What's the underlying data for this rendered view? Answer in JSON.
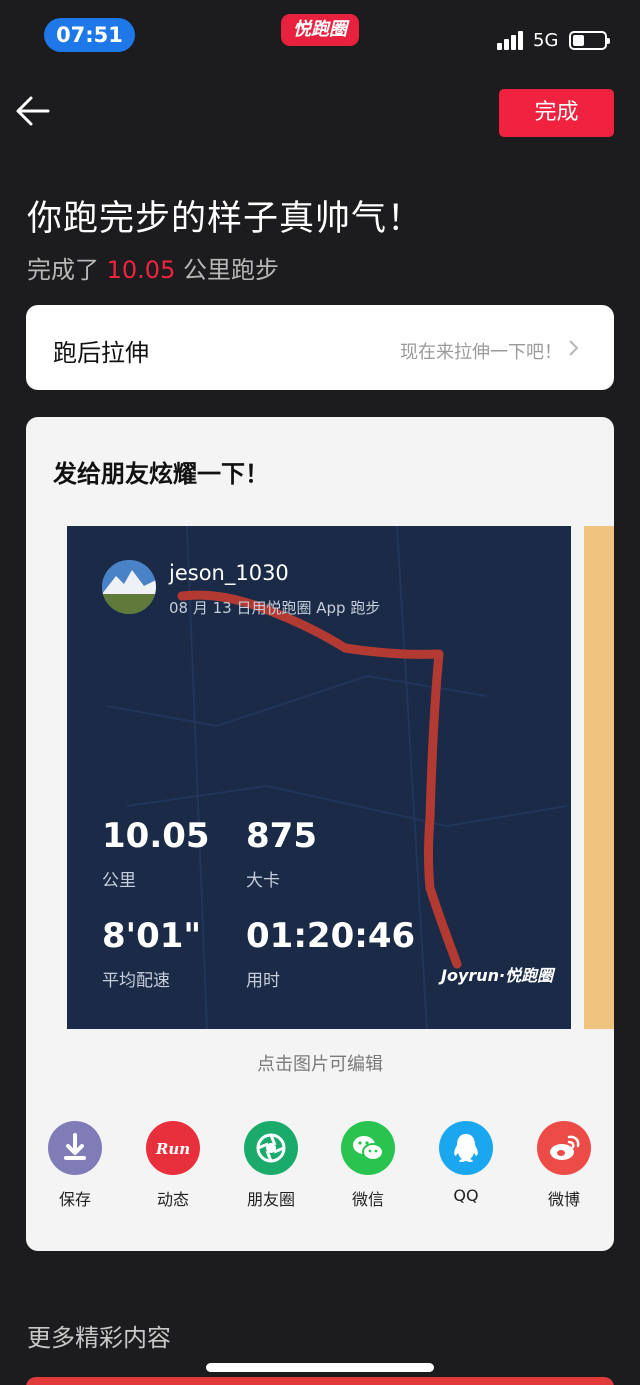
{
  "status_bar": {
    "time": "07:51",
    "app_logo": "悦跑圈",
    "network": "5G"
  },
  "nav": {
    "done_label": "完成"
  },
  "hero": {
    "title": "你跑完步的样子真帅气！",
    "sub_prefix": "完成了 ",
    "distance": "10.05",
    "sub_suffix": " 公里跑步"
  },
  "stretch": {
    "title": "跑后拉伸",
    "hint": "现在来拉伸一下吧！"
  },
  "share": {
    "title": "发给朋友炫耀一下！",
    "card": {
      "username": "jeson_1030",
      "date_line": "08 月 13 日用悦跑圈 App 跑步",
      "stats": [
        {
          "value": "10.05",
          "label": "公里"
        },
        {
          "value": "875",
          "label": "大卡"
        },
        {
          "value": "8'01\"",
          "label": "平均配速"
        },
        {
          "value": "01:20:46",
          "label": "用时"
        }
      ],
      "brand": "Joyrun·悦跑圈",
      "route_color": "#b33a32"
    },
    "edit_hint": "点击图片可编辑",
    "targets": [
      {
        "label": "保存",
        "icon": "download-icon",
        "color": "#7f7cb8"
      },
      {
        "label": "动态",
        "icon": "run-icon",
        "color": "#e8303c"
      },
      {
        "label": "朋友圈",
        "icon": "moments-icon",
        "color": "#1aab6a"
      },
      {
        "label": "微信",
        "icon": "wechat-icon",
        "color": "#28c44f"
      },
      {
        "label": "QQ",
        "icon": "qq-icon",
        "color": "#1aa7f0"
      },
      {
        "label": "微博",
        "icon": "weibo-icon",
        "color": "#ec4b47"
      }
    ]
  },
  "more": {
    "title": "更多精彩内容"
  }
}
